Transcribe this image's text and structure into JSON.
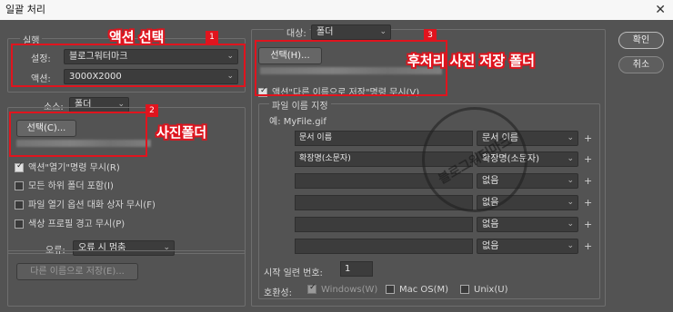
{
  "window": {
    "title": "일괄 처리",
    "close_glyph": "✕"
  },
  "play": {
    "legend": "실행",
    "set_label": "설정:",
    "set_value": "블로그워터마크",
    "action_label": "액션:",
    "action_value": "3000X2000"
  },
  "source": {
    "label": "소스:",
    "value": "폴더",
    "choose_button": "선택(C)...",
    "checks": [
      {
        "label": "액션\"열기\"명령 무시(R)",
        "checked": true
      },
      {
        "label": "모든 하위 폴더 포함(I)",
        "checked": false
      },
      {
        "label": "파일 열기 옵션 대화 상자 무시(F)",
        "checked": false
      },
      {
        "label": "색상 프로필 경고 무시(P)",
        "checked": false
      }
    ]
  },
  "errors": {
    "label": "오류:",
    "value": "오류 시 멈춤",
    "save_as_button": "다른 이름으로 저장(E)..."
  },
  "destination": {
    "label": "대상:",
    "value": "폴더",
    "choose_button": "선택(H)...",
    "override_label": "액션\"다른 이름으로 저장\"명령 무시(V)",
    "override_checked": true
  },
  "naming": {
    "legend": "파일 이름 지정",
    "example": "예: MyFile.gif",
    "rows": [
      {
        "left": "문서 이름",
        "right": "문서 이름"
      },
      {
        "left": "확장명(소문자)",
        "right": "확장명(소문자)"
      },
      {
        "left": "",
        "right": "없음"
      },
      {
        "left": "",
        "right": "없음"
      },
      {
        "left": "",
        "right": "없음"
      },
      {
        "left": "",
        "right": "없음"
      }
    ],
    "plus_glyph": "+",
    "serial_label": "시작 일련 번호:",
    "serial_value": "1",
    "compat_label": "호환성:",
    "compat": [
      {
        "label": "Windows(W)",
        "checked": true,
        "disabled": true
      },
      {
        "label": "Mac OS(M)",
        "checked": false,
        "disabled": false
      },
      {
        "label": "Unix(U)",
        "checked": false,
        "disabled": false
      }
    ]
  },
  "buttons": {
    "ok": "확인",
    "cancel": "취소"
  },
  "annotations": {
    "callout1": "액션 선택",
    "callout2": "사진폴더",
    "callout3": "후처리 사진 저장 폴더",
    "tag1": "1",
    "tag2": "2",
    "tag3": "3"
  },
  "watermark": {
    "text": "블로그워터마크"
  },
  "colors": {
    "dialog_bg": "#535353",
    "accent_red": "#e0141e"
  }
}
